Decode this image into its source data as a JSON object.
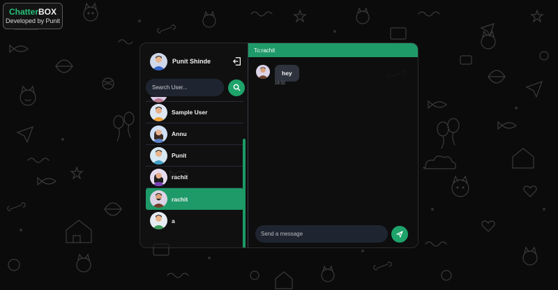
{
  "brand": {
    "title_part1": "Chatter",
    "title_part2": "BOX",
    "subtitle": "Developed by Punit"
  },
  "current_user": {
    "name": "Punit Shinde",
    "avatar": "avatar-male-icon"
  },
  "search": {
    "placeholder": "Search User..."
  },
  "users": [
    {
      "name": "Sample User",
      "avatar": "avatar-male-icon",
      "active": false
    },
    {
      "name": "Annu",
      "avatar": "avatar-female-icon",
      "active": false
    },
    {
      "name": "Punit",
      "avatar": "avatar-male-icon",
      "active": false
    },
    {
      "name": "rachit",
      "avatar": "avatar-female-icon",
      "active": false
    },
    {
      "name": "rachit",
      "avatar": "avatar-male-icon",
      "active": true
    },
    {
      "name": "a",
      "avatar": "avatar-male-icon",
      "active": false
    }
  ],
  "chat": {
    "to_label": "To:",
    "to_name": "rachit",
    "messages": [
      {
        "text": "hey",
        "time": "16:32"
      }
    ],
    "input_placeholder": "Send a message"
  },
  "colors": {
    "accent": "#1e9a68",
    "panel": "#1f2530",
    "background": "#0b0b0c"
  }
}
